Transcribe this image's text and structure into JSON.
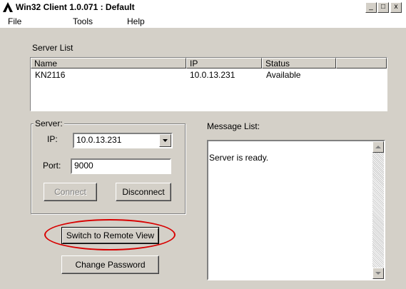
{
  "window": {
    "title": "Win32 Client 1.0.071 : Default"
  },
  "title_controls": {
    "minimize": "_",
    "maximize": "□",
    "close": "x"
  },
  "menubar": {
    "file": "File",
    "tools": "Tools",
    "help": "Help"
  },
  "server_list": {
    "label": "Server List",
    "columns": [
      "Name",
      "IP",
      "Status"
    ],
    "rows": [
      {
        "name": "KN2116",
        "ip": "10.0.13.231",
        "status": "Available"
      }
    ]
  },
  "server": {
    "label": "Server:",
    "ip_label": "IP:",
    "ip_value": "10.0.13.231",
    "port_label": "Port:",
    "port_value": "9000",
    "connect_label": "Connect",
    "disconnect_label": "Disconnect"
  },
  "buttons": {
    "switch_remote": "Switch to Remote View",
    "change_password": "Change Password"
  },
  "messages": {
    "label": "Message List:",
    "text": "Server is ready."
  },
  "colors": {
    "highlight": "#d80000",
    "face": "#d4d0c8"
  }
}
